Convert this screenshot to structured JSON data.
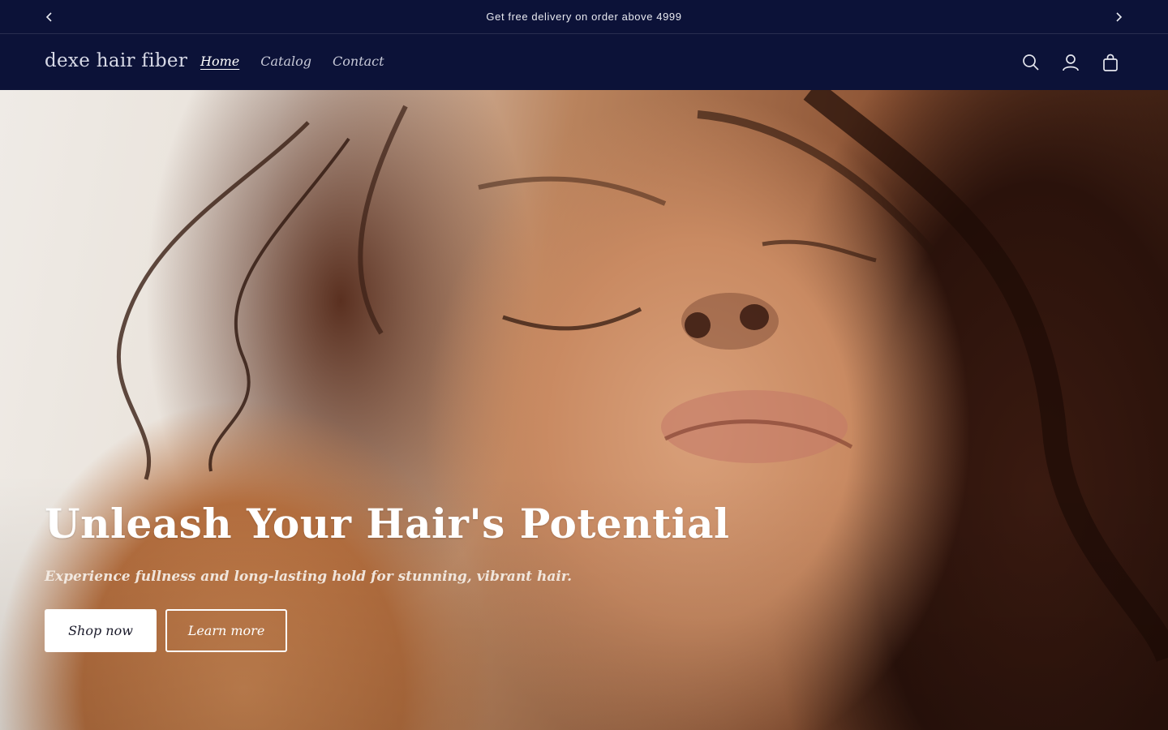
{
  "announcement": {
    "text": "Get free delivery on order above 4999",
    "prev_icon": "chevron-left-icon",
    "next_icon": "chevron-right-icon"
  },
  "header": {
    "logo": "dexe hair fiber",
    "nav": [
      {
        "label": "Home",
        "active": true
      },
      {
        "label": "Catalog",
        "active": false
      },
      {
        "label": "Contact",
        "active": false
      }
    ],
    "icons": [
      "search-icon",
      "account-icon",
      "cart-icon"
    ]
  },
  "hero": {
    "title": "Unleash Your Hair's Potential",
    "subtitle": "Experience fullness and long-lasting hold for stunning, vibrant hair.",
    "primary_button": "Shop now",
    "secondary_button": "Learn more"
  },
  "colors": {
    "header_bg": "#0c1238",
    "text_light": "#ffffff",
    "nav_text": "#c7c9d8"
  }
}
